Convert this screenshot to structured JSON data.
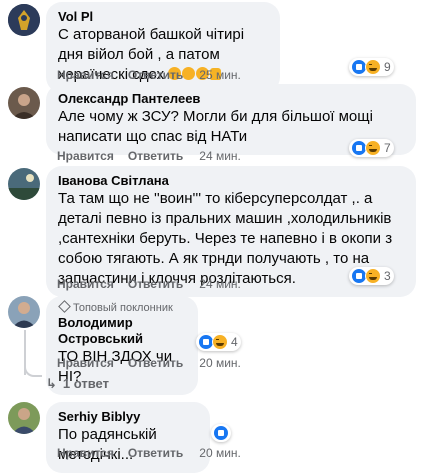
{
  "actions": {
    "like_label": "Нравится",
    "reply_label": "Ответить"
  },
  "comments": [
    {
      "author": "Vol Pl",
      "text": "С аторваной башкой чітирі дня війол бой , а патом хераїческі сдох",
      "emoji_count": 3,
      "time": "25 мин.",
      "reactions": [
        "like-icon",
        "haha-icon"
      ],
      "reaction_count": "9"
    },
    {
      "author": "Олександр Пантелеев",
      "text": "Але чому ж ЗСУ? Могли би для більшої мощі написати що спас від НАТи",
      "time": "24 мин.",
      "reactions": [
        "like-icon",
        "haha-icon"
      ],
      "reaction_count": "7"
    },
    {
      "author": "Іванова Світлана",
      "text": "Та там що не ''воин''' то кіберсуперсолдат ,. а деталі певно із пральних машин ,холодильників ,сантехніки беруть. Через те напевно і в окопи з собою тягають. А як трнди получають , то на запчастини і клоччя розлітаються.",
      "time": "24 мин.",
      "reactions": [
        "like-icon",
        "haha-icon"
      ],
      "reaction_count": "3"
    },
    {
      "badge": "Топовый поклонник",
      "author": "Володимир Островський",
      "text": "ТО ВІН ЗДОХ чи НІ?",
      "time": "20 мин.",
      "reactions": [
        "like-icon",
        "haha-icon"
      ],
      "reaction_count": "4",
      "replies_label": "1 ответ"
    },
    {
      "author": "Serhiy Biblyy",
      "text": "По радянській методічкі...",
      "time": "20 мин.",
      "reactions": [
        "like-icon"
      ]
    }
  ],
  "colors": {
    "bubble": "#f0f2f5",
    "meta": "#65676b",
    "like": "#1877f2",
    "haha": "#f7b125"
  }
}
